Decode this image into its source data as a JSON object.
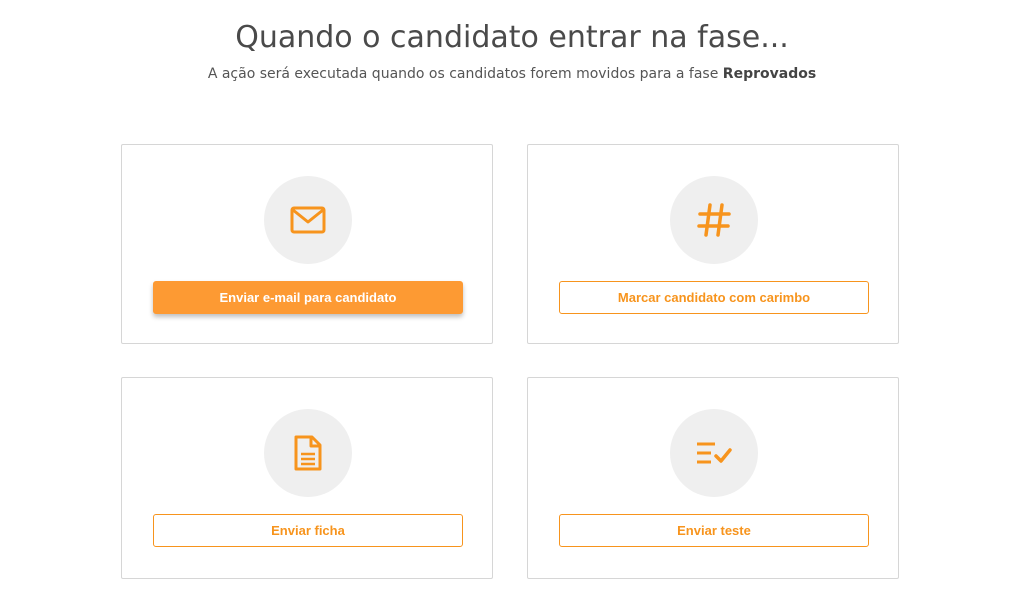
{
  "header": {
    "title": "Quando o candidato entrar na fase...",
    "subtitle_prefix": "A ação será executada quando os candidatos forem movidos para a fase ",
    "stage_name": "Reprovados"
  },
  "colors": {
    "accent": "#f7941d",
    "primary_button": "#fd9a33",
    "icon_circle": "#efefef",
    "card_border": "#d6d6d6"
  },
  "actions": [
    {
      "icon": "envelope-icon",
      "label": "Enviar e-mail para candidato",
      "selected": true
    },
    {
      "icon": "hashtag-icon",
      "label": "Marcar candidato com carimbo",
      "selected": false
    },
    {
      "icon": "document-icon",
      "label": "Enviar ficha",
      "selected": false
    },
    {
      "icon": "checklist-icon",
      "label": "Enviar teste",
      "selected": false
    }
  ]
}
